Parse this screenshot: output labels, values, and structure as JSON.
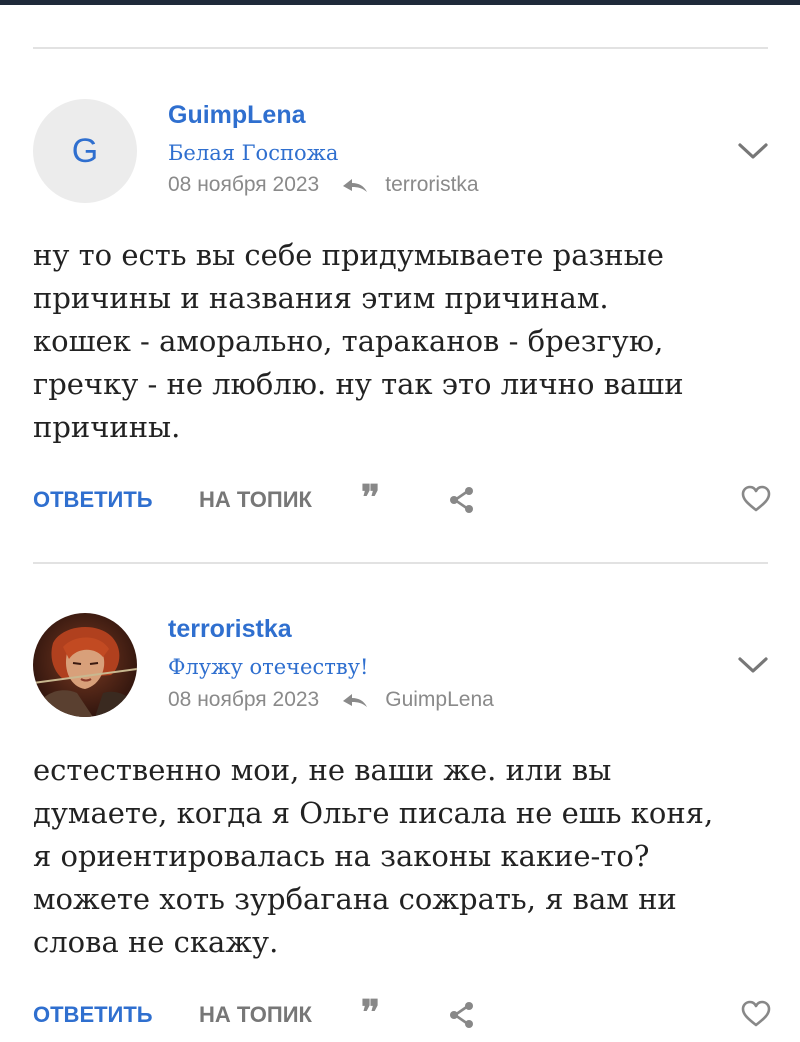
{
  "comments": [
    {
      "avatar_letter": "G",
      "username": "GuimpLena",
      "status": "Белая Госпожа",
      "date": "08 ноября 2023",
      "reply_to": "terroristka",
      "text_lines": [
        "ну то есть вы себе придумываете разные",
        "причины и названия этим причинам.",
        "кошек - аморально, тараканов - брезгую,",
        "гречку - не люблю. ну так это лично ваши",
        "причины."
      ]
    },
    {
      "avatar_letter": "",
      "username": "terroristka",
      "status": "Флужу отечеству!",
      "date": "08 ноября 2023",
      "reply_to": "GuimpLena",
      "text_lines": [
        "естественно мои, не ваши же. или вы",
        "думаете, когда я Ольге писала не ешь коня,",
        "я ориентировалась на законы какие-то?",
        "можете хоть зурбагана сожрать, я вам ни",
        "слова не скажу."
      ]
    }
  ],
  "actions": {
    "reply_label": "ОТВЕТИТЬ",
    "to_topic_label": "НА ТОПИК",
    "quote_glyph": "❜❜"
  },
  "icons": {
    "reply_indicator": "reply-arrow-icon",
    "expand": "chevron-down-icon",
    "quote": "quote-icon",
    "share": "share-icon",
    "like": "heart-icon"
  },
  "colors": {
    "accent": "#2f6fcf",
    "muted": "#8a8a8a",
    "divider": "#e2e2e2"
  }
}
